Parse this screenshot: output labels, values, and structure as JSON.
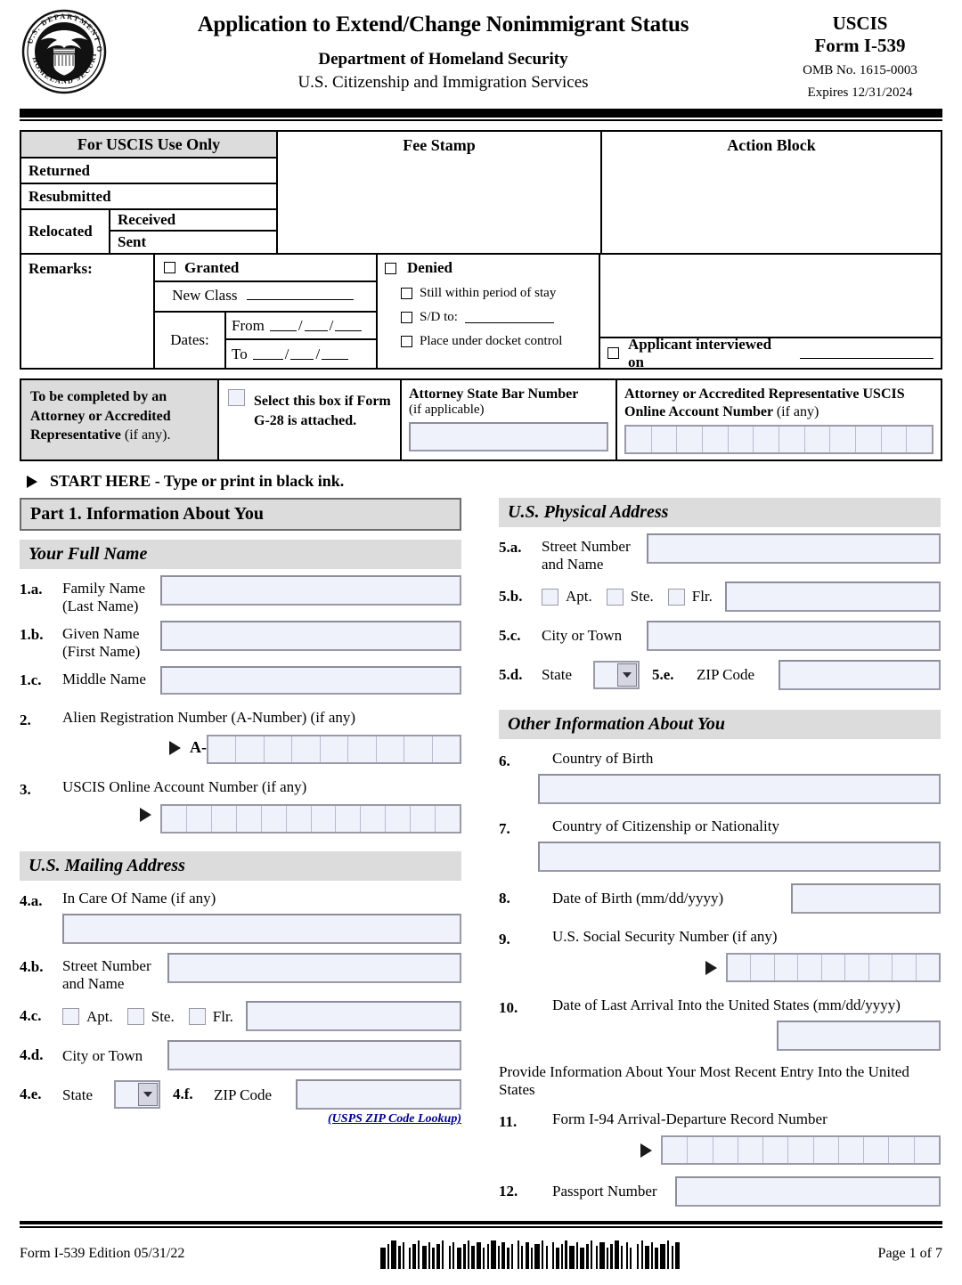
{
  "header": {
    "title": "Application to Extend/Change Nonimmigrant Status",
    "sub1": "Department of Homeland Security",
    "sub2": "U.S. Citizenship and Immigration Services",
    "agency": "USCIS",
    "form_no": "Form I-539",
    "omb": "OMB No. 1615-0003",
    "expires": "Expires 12/31/2024",
    "seal_alt": "dhs-seal"
  },
  "uscis_block": {
    "heading": "For USCIS Use Only",
    "returned": "Returned",
    "resubmitted": "Resubmitted",
    "relocated": "Relocated",
    "received": "Received",
    "sent": "Sent",
    "fee_stamp": "Fee Stamp",
    "action_block": "Action Block",
    "remarks": "Remarks:",
    "granted": "Granted",
    "new_class": "New Class",
    "dates": "Dates:",
    "from": "From",
    "to": "To",
    "slash": "/",
    "denied": "Denied",
    "still_within": "Still within period of stay",
    "sd_to": "S/D to:",
    "docket": "Place under docket control",
    "applicant_interviewed": "Applicant interviewed on"
  },
  "attorney": {
    "to_be_completed_bold": "To be completed by an Attorney or Accredited Representative",
    "to_be_completed_light": "(if any).",
    "select_box": "Select this box if Form G-28 is attached.",
    "bar_number_title": "Attorney State Bar Number",
    "bar_number_note": "(if applicable)",
    "acct_title": "Attorney or Accredited Representative USCIS Online Account Number",
    "acct_note": "(if any)",
    "acct_cells": 12
  },
  "start_here": "START HERE - Type or print in black ink.",
  "part1": {
    "title": "Part 1.  Information About You",
    "full_name_heading": "Your Full Name",
    "items": [
      {
        "num": "1.a.",
        "label": "Family Name\n(Last Name)"
      },
      {
        "num": "1.b.",
        "label": "Given Name\n(First Name)"
      },
      {
        "num": "1.c.",
        "label": "Middle Name"
      }
    ],
    "item2": {
      "num": "2.",
      "label": "Alien Registration Number (A-Number) (if any)",
      "prefix": "A-",
      "cells": 9
    },
    "item3": {
      "num": "3.",
      "label": "USCIS Online Account Number (if any)",
      "cells": 12
    },
    "mailing_heading": "U.S. Mailing Address",
    "mailing": {
      "a": {
        "num": "4.a.",
        "label": "In Care Of Name (if any)"
      },
      "b": {
        "num": "4.b.",
        "label": "Street Number\nand Name"
      },
      "c": {
        "num": "4.c.",
        "apt": "Apt.",
        "ste": "Ste.",
        "flr": "Flr."
      },
      "d": {
        "num": "4.d.",
        "label": "City or Town"
      },
      "e": {
        "num": "4.e.",
        "label": "State"
      },
      "f": {
        "num": "4.f.",
        "label": "ZIP Code"
      },
      "zip_lookup": "(USPS ZIP Code Lookup)"
    }
  },
  "right": {
    "physical_heading": "U.S. Physical Address",
    "physical": {
      "a": {
        "num": "5.a.",
        "label": "Street Number\nand Name"
      },
      "b": {
        "num": "5.b.",
        "apt": "Apt.",
        "ste": "Ste.",
        "flr": "Flr."
      },
      "c": {
        "num": "5.c.",
        "label": "City or Town"
      },
      "d": {
        "num": "5.d.",
        "label": "State"
      },
      "e": {
        "num": "5.e.",
        "label": "ZIP Code"
      }
    },
    "other_heading": "Other Information About You",
    "item6": {
      "num": "6.",
      "label": "Country of Birth"
    },
    "item7": {
      "num": "7.",
      "label": "Country of Citizenship or Nationality"
    },
    "item8": {
      "num": "8.",
      "label": "Date of Birth (mm/dd/yyyy)"
    },
    "item9": {
      "num": "9.",
      "label": "U.S. Social Security Number (if any)",
      "cells": 9
    },
    "item10": {
      "num": "10.",
      "label": "Date of Last Arrival Into the United States (mm/dd/yyyy)"
    },
    "entry_note": "Provide Information About Your Most Recent Entry Into the United States",
    "item11": {
      "num": "11.",
      "label": "Form I-94 Arrival-Departure Record Number",
      "cells": 11
    },
    "item12": {
      "num": "12.",
      "label": "Passport Number"
    }
  },
  "footer": {
    "form_edition": "Form I-539   Edition   05/31/22",
    "page": "Page 1 of 7",
    "barcode_alt": "form-barcode"
  },
  "colors": {
    "field_fill": "#eff1fb",
    "field_border": "#9a9aa8",
    "section_gray": "#dcdcdc",
    "link_blue": "#00008f"
  }
}
